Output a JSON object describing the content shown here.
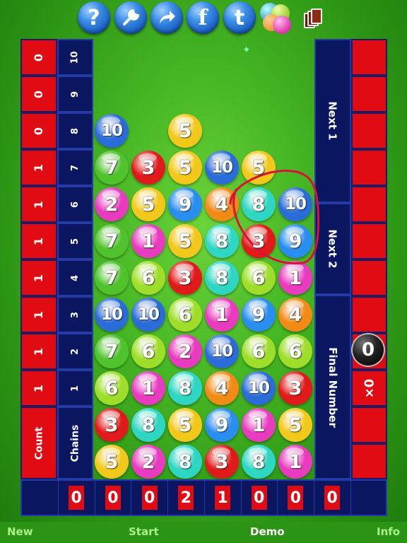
{
  "toolbar": {
    "help_glyph": "?",
    "facebook_glyph": "f",
    "twitter_glyph": "t",
    "icons": [
      "help-icon",
      "wrench-icon",
      "share-arrow-icon",
      "facebook-icon",
      "twitter-icon",
      "game-center-icon",
      "cards-icon"
    ]
  },
  "left": {
    "count_values": [
      "0",
      "0",
      "0",
      "1",
      "1",
      "1",
      "1",
      "1",
      "1",
      "1"
    ],
    "chain_numbers": [
      "10",
      "9",
      "8",
      "7",
      "6",
      "5",
      "4",
      "3",
      "2",
      "1"
    ],
    "count_label": "Count",
    "chains_label": "Chains"
  },
  "right": {
    "next1_label": "Next 1",
    "next2_label": "Next 2",
    "final_label": "Final Number",
    "final_value": "0",
    "multiplier": "×0"
  },
  "board": {
    "rows": [
      [
        null,
        null,
        null,
        null,
        null,
        null
      ],
      [
        null,
        null,
        null,
        null,
        null,
        null
      ],
      [
        "10",
        null,
        "5",
        null,
        null,
        null
      ],
      [
        "7",
        "3",
        "5",
        "10",
        "5",
        null
      ],
      [
        "2",
        "5",
        "9",
        "4",
        "8",
        "10"
      ],
      [
        "7",
        "1",
        "5",
        "8",
        "3",
        "9"
      ],
      [
        "7",
        "6",
        "3",
        "8",
        "6",
        "1"
      ],
      [
        "10",
        "10",
        "6",
        "1",
        "9",
        "4"
      ],
      [
        "7",
        "6",
        "2",
        "10",
        "6",
        "6"
      ],
      [
        "6",
        "1",
        "8",
        "4",
        "10",
        "3"
      ],
      [
        "3",
        "8",
        "5",
        "9",
        "1",
        "5"
      ],
      [
        "5",
        "2",
        "8",
        "3",
        "8",
        "1"
      ]
    ],
    "colors": {
      "1": "#e83bbf",
      "2": "#e83bbf",
      "3": "#e01a1a",
      "4": "#f28a16",
      "5": "#f2c81a",
      "6": "#9ede2a",
      "7": "#4fc22c",
      "8": "#2fd6c2",
      "9": "#2a8ef0",
      "10": "#2a6cd8"
    }
  },
  "bottom_counts": [
    "",
    "0",
    "0",
    "0",
    "2",
    "1",
    "0",
    "0",
    "0",
    ""
  ],
  "nav": {
    "new": "New",
    "start": "Start",
    "demo": "Demo",
    "info": "Info"
  }
}
